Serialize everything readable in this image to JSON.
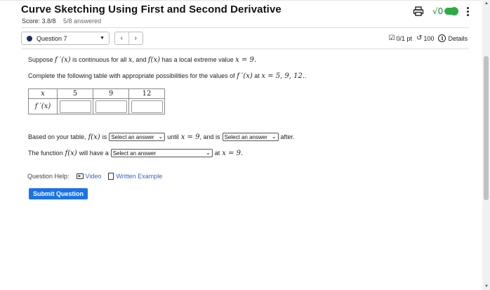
{
  "header": {
    "title": "Curve Sketching Using First and Second Derivative",
    "score": "Score: 3.8/8",
    "answered": "5/8 answered",
    "icons": {
      "print": "printer-icon",
      "math": "sqrt-icon",
      "toggle": "toggle-switch",
      "menu": "kebab-menu-icon"
    },
    "sqrt_glyph": "√0"
  },
  "nav": {
    "question_label": "Question 7",
    "prev": "‹",
    "next": "›",
    "points": "0/1 pt",
    "attempts": "100",
    "details": "Details"
  },
  "problem": {
    "intro_a": "Suppose",
    "fprime": "f ′(x)",
    "intro_b": "is continuous for all",
    "x": "x",
    "intro_c": ", and",
    "fx": "f(x)",
    "intro_d": "has a local extreme value",
    "eq": "x = 9.",
    "instr_a": "Complete the following table with appropriate possibilities for the values of",
    "instr_b": "at",
    "instr_eq": "x = 5, 9, 12.",
    "instr_end": "."
  },
  "table": {
    "headers": [
      "x",
      "5",
      "9",
      "12"
    ],
    "row_label": "f ′(x)",
    "values": [
      "",
      "",
      ""
    ]
  },
  "sentence1": {
    "a": "Based on your table,",
    "fx": "f(x)",
    "b": "is",
    "select1": "Select an answer",
    "c": "until",
    "eq": "x = 9",
    "d": ", and is",
    "select2": "Select an answer",
    "e": "after."
  },
  "sentence2": {
    "a": "The function",
    "fx": "f(x)",
    "b": "will have a",
    "select": "Select an answer",
    "c": "at",
    "eq": "x = 9."
  },
  "help": {
    "label": "Question Help:",
    "video": "Video",
    "written": "Written Example"
  },
  "submit_label": "Submit Question",
  "colors": {
    "accent": "#1a73e8",
    "toggle": "#2eaa45",
    "link": "#3a64c8",
    "question_dot": "#1f2a6b"
  }
}
